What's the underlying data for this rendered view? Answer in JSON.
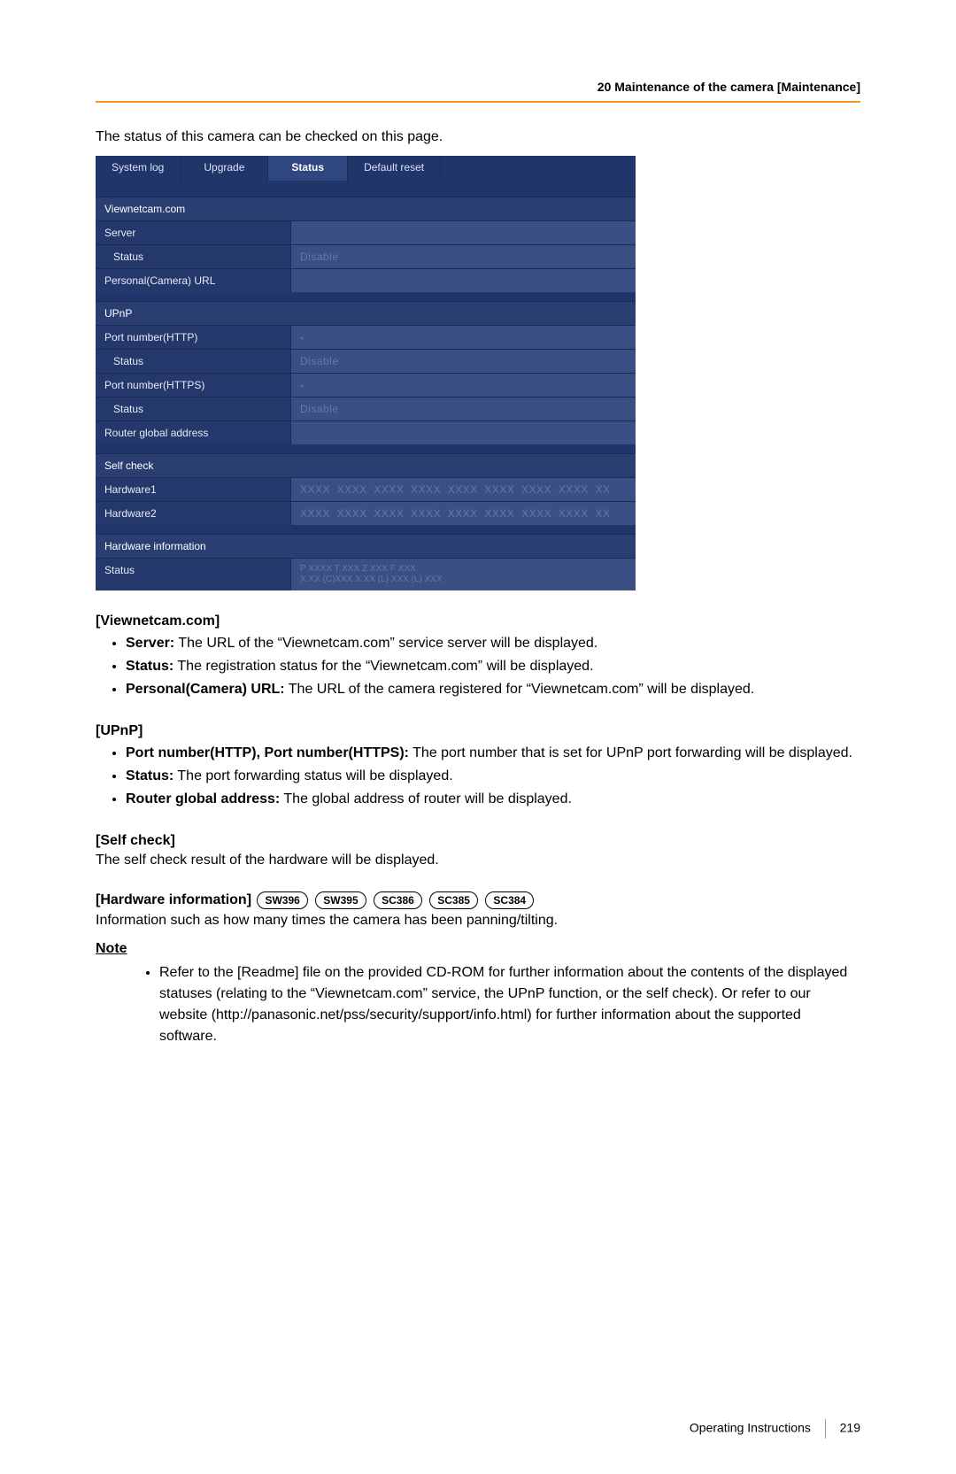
{
  "header": {
    "text": "20 Maintenance of the camera [Maintenance]"
  },
  "intro": "The status of this camera can be checked on this page.",
  "tabs": {
    "items": [
      "System log",
      "Upgrade",
      "Status",
      "Default reset"
    ],
    "activeIndex": 2
  },
  "screenshot": {
    "groups": [
      {
        "header": "Viewnetcam.com",
        "rows": [
          {
            "label": "Server",
            "value": ""
          },
          {
            "label": "Status",
            "value": "Disable",
            "indent": true,
            "blur": true
          },
          {
            "label": "Personal(Camera) URL",
            "value": ""
          }
        ]
      },
      {
        "header": "UPnP",
        "rows": [
          {
            "label": "Port number(HTTP)",
            "value": "-"
          },
          {
            "label": "Status",
            "value": "Disable",
            "indent": true,
            "blur": true
          },
          {
            "label": "Port number(HTTPS)",
            "value": "-"
          },
          {
            "label": "Status",
            "value": "Disable",
            "indent": true,
            "blur": true
          },
          {
            "label": "Router global address",
            "value": ""
          }
        ]
      },
      {
        "header": "Self check",
        "rows": [
          {
            "label": "Hardware1",
            "value": "XXXX  XXXX  XXXX  XXXX  XXXX  XXXX  XXXX  XXXX  XX",
            "blur": true
          },
          {
            "label": "Hardware2",
            "value": "XXXX  XXXX  XXXX  XXXX  XXXX  XXXX  XXXX  XXXX  XX",
            "blur": true
          }
        ]
      },
      {
        "header": "Hardware information",
        "rows": [
          {
            "label": "Status",
            "value_lines": [
              "P XXXX T XXX Z XXX F XXX",
              "X.XX (C)XXX X.XX (L) XXX (L) XXX"
            ],
            "blur2": true
          }
        ]
      }
    ]
  },
  "sections": {
    "viewnetcam": {
      "title": "[Viewnetcam.com]",
      "bullets": [
        {
          "bold": "Server:",
          "rest": " The URL of the “Viewnetcam.com” service server will be displayed."
        },
        {
          "bold": "Status:",
          "rest": " The registration status for the “Viewnetcam.com” will be displayed."
        },
        {
          "bold": "Personal(Camera) URL:",
          "rest": " The URL of the camera registered for “Viewnetcam.com” will be displayed."
        }
      ]
    },
    "upnp": {
      "title": "[UPnP]",
      "bullets": [
        {
          "bold": "Port number(HTTP), Port number(HTTPS):",
          "rest": " The port number that is set for UPnP port forwarding will be displayed."
        },
        {
          "bold": "Status:",
          "rest": " The port forwarding status will be displayed."
        },
        {
          "bold": "Router global address:",
          "rest": " The global address of router will be displayed."
        }
      ]
    },
    "selfcheck": {
      "title": "[Self check]",
      "para": "The self check result of the hardware will be displayed."
    },
    "hwinfo": {
      "title": "[Hardware information]",
      "pills": [
        "SW396",
        "SW395",
        "SC386",
        "SC385",
        "SC384"
      ],
      "para": "Information such as how many times the camera has been panning/tilting."
    }
  },
  "note": {
    "heading": "Note",
    "text": "Refer to the [Readme] file on the provided CD-ROM for further information about the contents of the displayed statuses (relating to the “Viewnetcam.com” service, the UPnP function, or the self check). Or refer to our website (http://panasonic.net/pss/security/support/info.html) for further information about the supported software."
  },
  "footer": {
    "label": "Operating Instructions",
    "page": "219"
  }
}
